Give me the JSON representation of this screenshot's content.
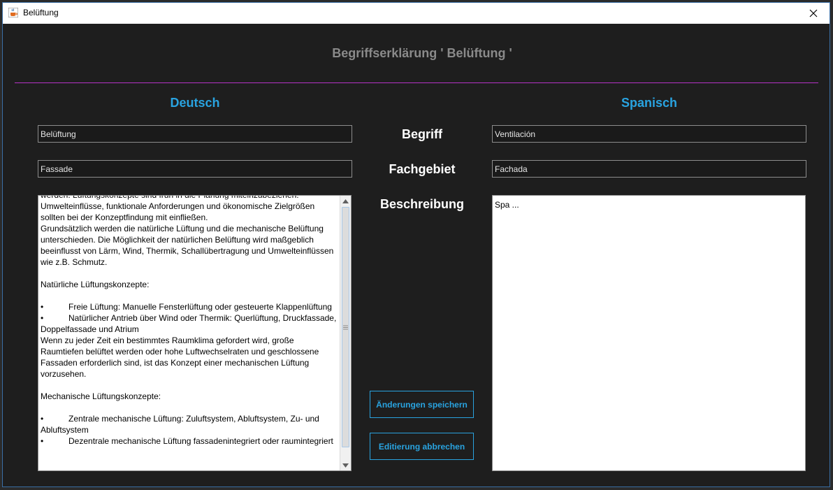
{
  "window": {
    "title": "Belüftung"
  },
  "heading": "Begriffserklärung ' Belüftung '",
  "columns": {
    "left": "Deutsch",
    "right": "Spanisch"
  },
  "labels": {
    "term": "Begriff",
    "field": "Fachgebiet",
    "description": "Beschreibung"
  },
  "deutsch": {
    "term": "Belüftung",
    "field": "Fassade",
    "description": "werden. Lüftungskonzepte sind früh in die Planung miteinzubeziehen.\nUmwelteinflüsse, funktionale Anforderungen und ökonomische Zielgrößen sollten bei der Konzeptfindung mit einfließen.\nGrundsätzlich werden die natürliche Lüftung und die mechanische Belüftung unterschieden. Die Möglichkeit der natürlichen Belüftung wird maßgeblich beeinflusst von Lärm, Wind, Thermik, Schallübertragung und Umwelteinflüssen wie z.B. Schmutz.\n\nNatürliche Lüftungskonzepte:\n\n•\t\t\tFreie Lüftung: Manuelle Fensterlüftung oder gesteuerte Klappenlüftung\n•\t\t\tNatürlicher Antrieb über Wind oder Thermik: Querlüftung, Druckfassade, Doppelfassade und Atrium\nWenn zu jeder Zeit ein bestimmtes Raumklima gefordert wird, große Raumtiefen belüftet werden oder hohe Luftwechselraten und geschlossene Fassaden erforderlich sind, ist das Konzept einer mechanischen Lüftung vorzusehen.\n\nMechanische Lüftungskonzepte:\n\n•\t\t\tZentrale mechanische Lüftung: Zuluftsystem, Abluftsystem, Zu- und Abluftsystem\n•\t\t\tDezentrale mechanische Lüftung fassadenintegriert oder raumintegriert"
  },
  "spanisch": {
    "term": "Ventilación",
    "field": "Fachada",
    "description": "Spa ..."
  },
  "buttons": {
    "save": "Änderungen speichern",
    "cancel": "Editierung abbrechen"
  },
  "colors": {
    "background": "#1e1e1e",
    "accent": "#29a3e0",
    "divider": "#b533c7",
    "heading": "#8a8a8a"
  },
  "icons": {
    "app": "java-cup-icon",
    "close": "close-icon"
  }
}
